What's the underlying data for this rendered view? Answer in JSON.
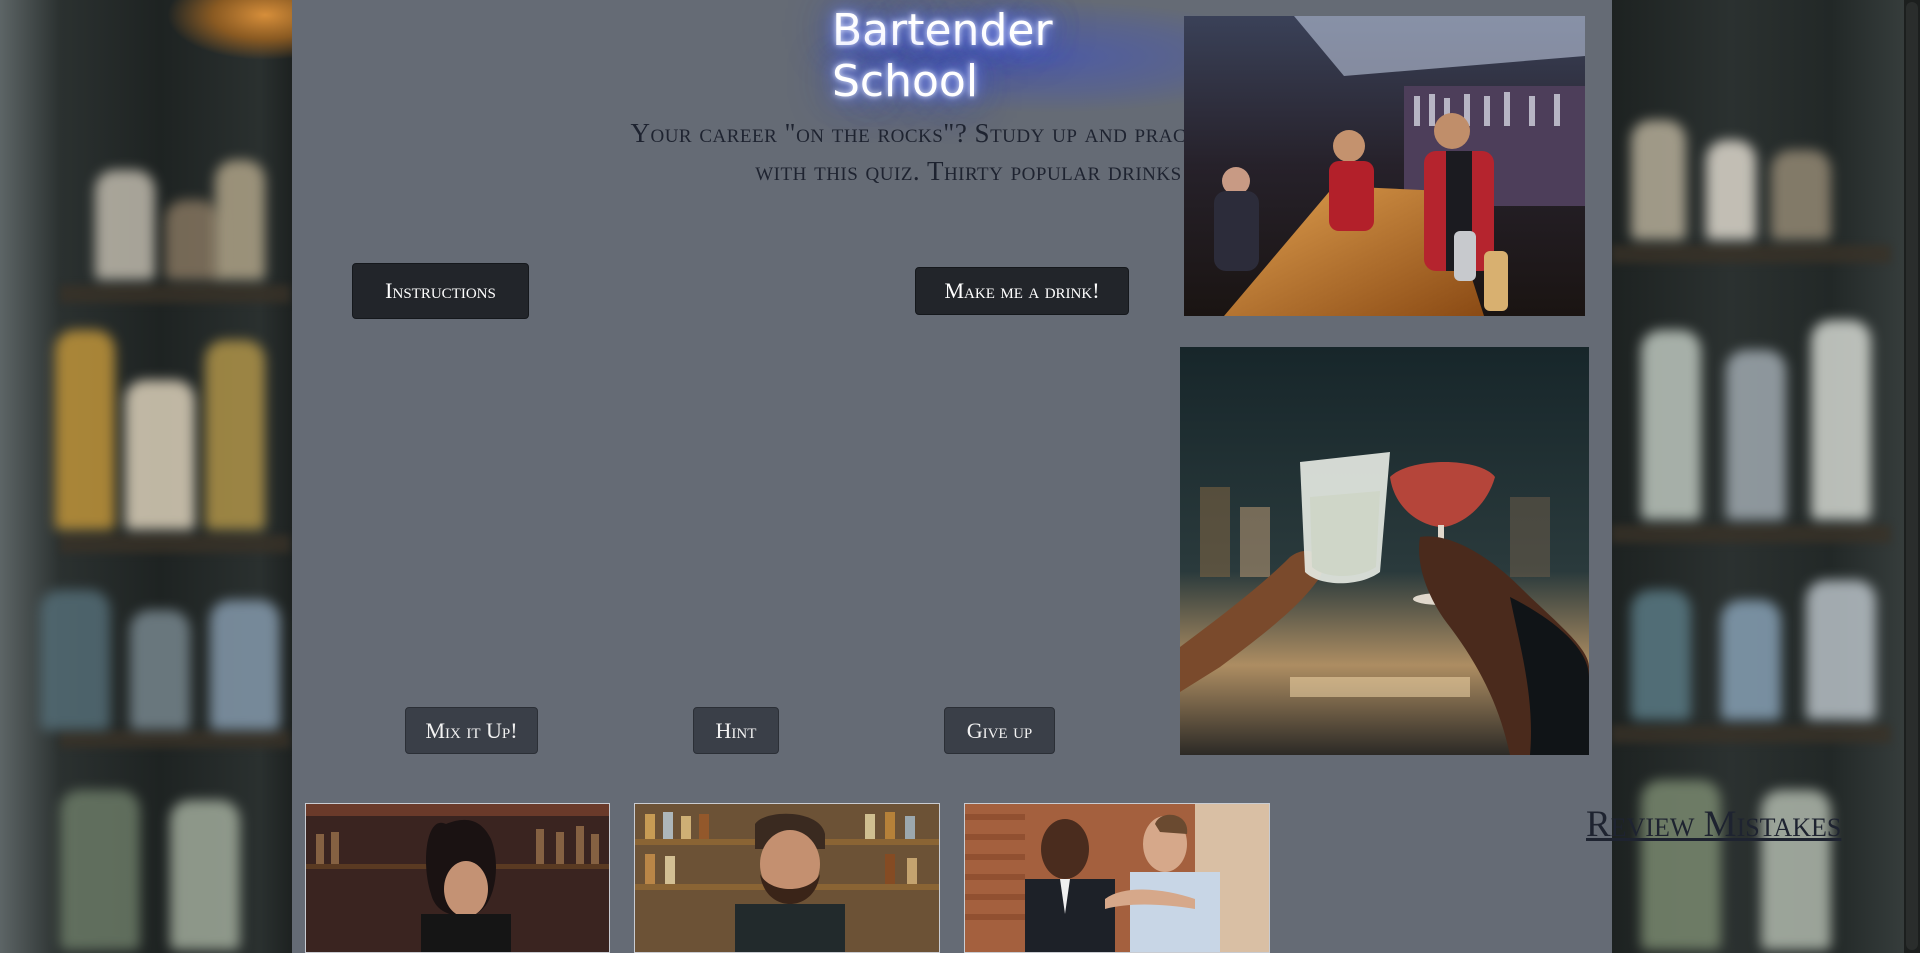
{
  "app": {
    "title": "Bartender School",
    "subtitle": "Your career \"on the rocks\"? Study up and practice what you learn with this quiz. Thirty popular drinks to know!"
  },
  "buttons": {
    "instructions": "Instructions",
    "make_drink": "Make me a drink!",
    "mix": "Mix it Up!",
    "hint": "Hint",
    "give_up": "Give up"
  },
  "links": {
    "review": "Review Mistakes"
  },
  "images": {
    "top": "bar-counter-photo",
    "middle": "cocktail-toast-photo",
    "bottom": [
      "bartender-curly-hair-photo",
      "bartender-bearded-photo",
      "men-tasting-drinks-photo"
    ]
  },
  "colors": {
    "panel": "#656b75",
    "button_dark": "#22252a",
    "button_mid": "#3a3f48",
    "title_glow": "#3b56e8"
  }
}
